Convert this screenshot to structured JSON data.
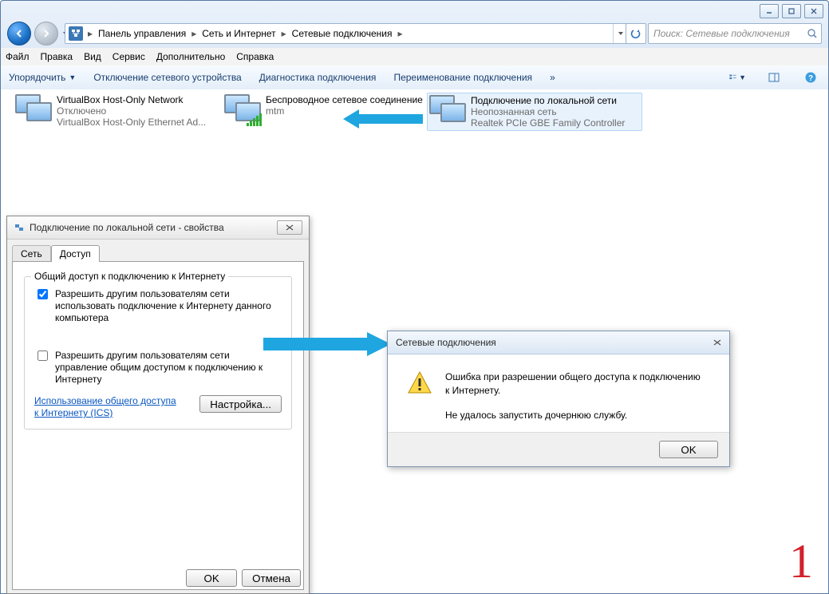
{
  "breadcrumb": {
    "seg1": "Панель управления",
    "seg2": "Сеть и Интернет",
    "seg3": "Сетевые подключения"
  },
  "search": {
    "placeholder": "Поиск: Сетевые подключения"
  },
  "menu": {
    "file": "Файл",
    "edit": "Правка",
    "view": "Вид",
    "tools": "Сервис",
    "extra": "Дополнительно",
    "help": "Справка"
  },
  "toolbar": {
    "organize": "Упорядочить",
    "disable": "Отключение сетевого устройства",
    "diag": "Диагностика подключения",
    "rename": "Переименование подключения",
    "more": "»"
  },
  "connections": [
    {
      "title": "VirtualBox Host-Only Network",
      "status": "Отключено",
      "detail": "VirtualBox Host-Only Ethernet Ad..."
    },
    {
      "title": "Беспроводное сетевое соединение",
      "sub": "",
      "detail": "mtm"
    },
    {
      "title": "Подключение по локальной сети",
      "status": "Неопознанная сеть",
      "detail": "Realtek PCIe GBE Family Controller"
    }
  ],
  "propdlg": {
    "title": "Подключение по локальной сети - свойства",
    "tab_net": "Сеть",
    "tab_access": "Доступ",
    "group": "Общий доступ к подключению к Интернету",
    "chk1": "Разрешить другим пользователям сети использовать подключение к Интернету данного компьютера",
    "chk2": "Разрешить другим пользователям сети управление общим доступом к подключению к Интернету",
    "link": "Использование общего доступа к Интернету (ICS)",
    "settings": "Настройка...",
    "ok": "OK",
    "cancel": "Отмена"
  },
  "errdlg": {
    "title": "Сетевые подключения",
    "line1": "Ошибка при разрешении общего доступа к подключению к Интернету.",
    "line2": "Не удалось запустить дочернюю службу.",
    "ok": "OK"
  },
  "bignum": "1"
}
